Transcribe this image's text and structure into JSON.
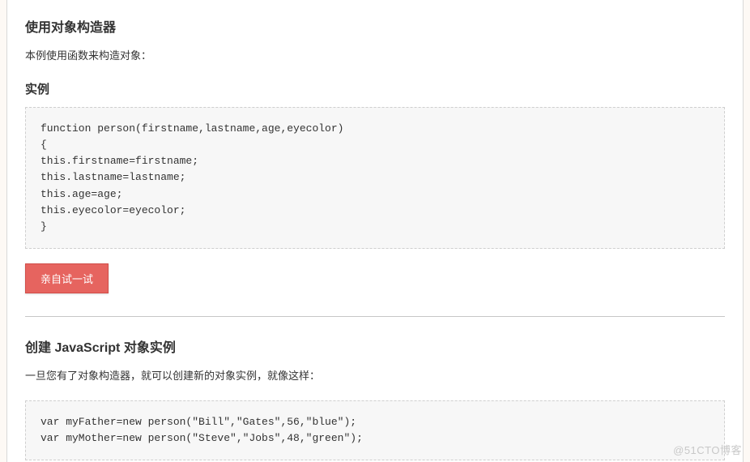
{
  "section1": {
    "heading": "使用对象构造器",
    "description": "本例使用函数来构造对象：",
    "example_label": "实例",
    "code": "function person(firstname,lastname,age,eyecolor)\n{\nthis.firstname=firstname;\nthis.lastname=lastname;\nthis.age=age;\nthis.eyecolor=eyecolor;\n}",
    "try_button": "亲自试一试"
  },
  "section2": {
    "heading": "创建 JavaScript 对象实例",
    "description": "一旦您有了对象构造器，就可以创建新的对象实例，就像这样：",
    "code": "var myFather=new person(\"Bill\",\"Gates\",56,\"blue\");\nvar myMother=new person(\"Steve\",\"Jobs\",48,\"green\");"
  },
  "watermark": "@51CTO博客"
}
